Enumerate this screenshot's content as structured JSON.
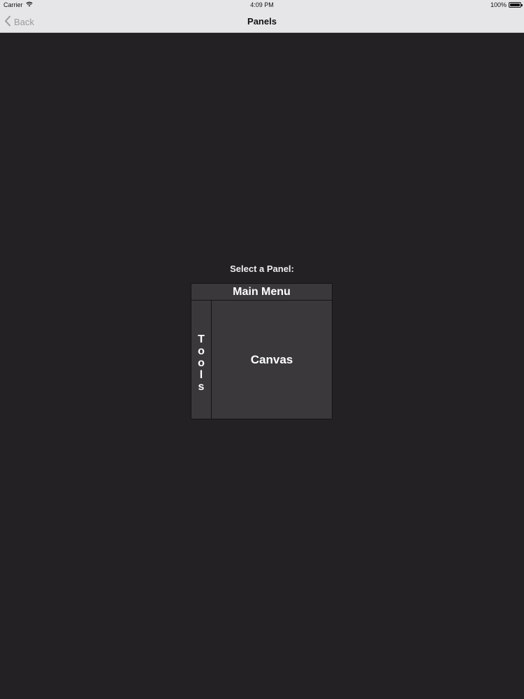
{
  "status_bar": {
    "carrier": "Carrier",
    "time": "4:09 PM",
    "battery": "100%"
  },
  "nav": {
    "back_label": "Back",
    "title": "Panels"
  },
  "content": {
    "prompt": "Select a Panel:",
    "panels": {
      "main_menu": "Main Menu",
      "tools_letters": [
        "T",
        "o",
        "o",
        "l",
        "s"
      ],
      "canvas": "Canvas"
    }
  },
  "colors": {
    "background": "#232124",
    "panel_fill": "#3a383b",
    "nav_background": "#e6e6e8"
  }
}
